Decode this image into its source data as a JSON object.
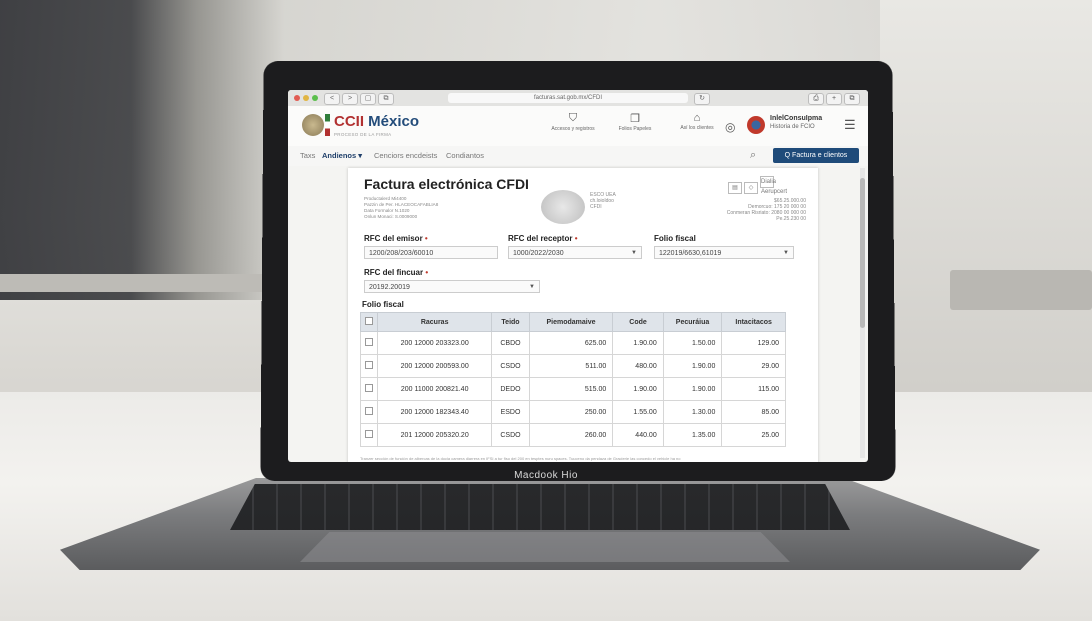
{
  "browser": {
    "url": "facturas.sat.gob.mx/CFDI",
    "back_label": "<",
    "forward_label": ">",
    "reader_label": "▢",
    "tab_label": "⧉",
    "reload_label": "↻",
    "share_label": "⎙",
    "newtab_label": "+",
    "tabs_label": "⧉"
  },
  "header": {
    "logo_main": "CCII",
    "logo_country": " México",
    "logo_sub": "PROCESO DE LA FIRMA",
    "items": [
      {
        "icon": "shield-icon",
        "label": "Accesos y registros"
      },
      {
        "icon": "files-icon",
        "label": "Folios Papeles"
      },
      {
        "icon": "bank-icon",
        "label": "Así los clientes"
      }
    ],
    "user": {
      "name": "InlelConsuIpma",
      "sub": "Historia de FCIO"
    }
  },
  "nav": {
    "items": [
      {
        "label": "Taxs",
        "active": false
      },
      {
        "label": "Andienos ▾",
        "active": true
      },
      {
        "label": "Cenciors encdeists",
        "active": false
      },
      {
        "label": "Condiantos",
        "active": false
      }
    ],
    "cta_label": "Q  Factura e clientos"
  },
  "document": {
    "title": "Factura electrónica CFDI",
    "meta_lines": [
      "Productalerd Mi4400",
      "Pazzin de Per. HLACEOCAFABLIA8",
      "Data Formalor N.1020",
      "Onlun Monaci: S.0009000"
    ],
    "seal_lines": [
      "ESCO UEA",
      "ch.loioldoo",
      "CFDI"
    ],
    "icon_tag": "Dialia Aerupcert",
    "amounts": [
      "$65.25.000.00",
      "Demorcuo: 175 20 000 00",
      "Conmeran Risriato: 2080 00 000 00",
      "Pe.25.230 00"
    ],
    "rfc_emisor_label": "RFC del emisor",
    "rfc_emisor_value": "1200/208/203/60010",
    "rfc_receptor_label": "RFC del receptor",
    "rfc_receptor_value": "1000/2022/2030",
    "folio_label": "Folio fiscal",
    "folio_value": "122019/6630,61019",
    "rfc_fincuar_label": "RFC del fincuar",
    "rfc_fincuar_value": "20192.20019",
    "folio_fiscal_label": "Folio fiscal",
    "table": {
      "headers": [
        "",
        "Racuras",
        "Teido",
        "Piemodamaive",
        "Code",
        "Pecuráiua",
        "Intacitacos"
      ],
      "rows": [
        [
          "200 12000 203323.00",
          "CBDO",
          "625.00",
          "1.90.00",
          "1.50.00",
          "129.00"
        ],
        [
          "200 12000 200593.00",
          "CSDO",
          "511.00",
          "480.00",
          "1.90.00",
          "29.00"
        ],
        [
          "200 11000 200821.40",
          "DEDO",
          "515.00",
          "1.90.00",
          "1.90.00",
          "115.00"
        ],
        [
          "200 12000 182343.40",
          "ESDO",
          "250.00",
          "1.55.00",
          "1.30.00",
          "85.00"
        ],
        [
          "201 12000 205320.20",
          "CSDO",
          "260.00",
          "440.00",
          "1.35.00",
          "25.00"
        ]
      ]
    },
    "footnote": "Tranzer sección de función de albercas de la docia camera diarrera en IFSI a tur fiso del 200 en tesptes nuru spaces. Tuuceno da pendaza de Gracierie las concedo el vehicle ha no"
  },
  "laptop": {
    "label": "Macdook Hio"
  }
}
